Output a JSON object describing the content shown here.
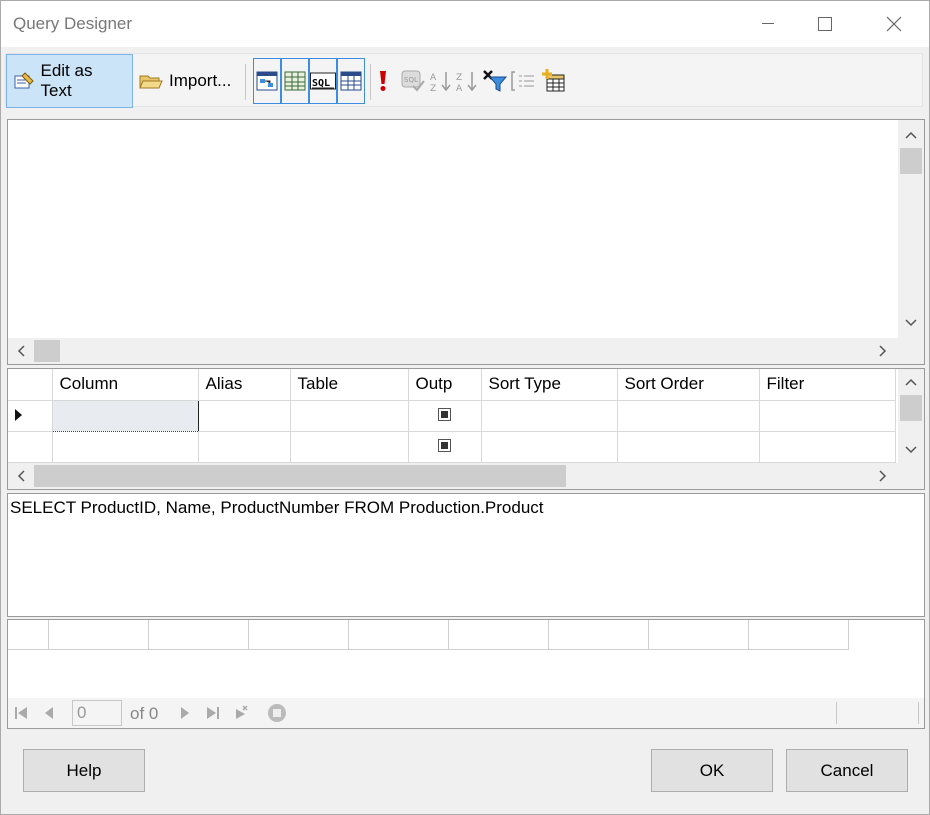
{
  "window": {
    "title": "Query Designer"
  },
  "toolbar": {
    "edit_as_text": "Edit as Text",
    "import": "Import...",
    "sql_icon_text": "SQL"
  },
  "grid": {
    "columns": [
      "",
      "Column",
      "Alias",
      "Table",
      "Outp",
      "Sort Type",
      "Sort Order",
      "Filter"
    ],
    "rows": [
      {
        "selected": true,
        "output_checked": true
      },
      {
        "selected": false,
        "output_checked": true
      }
    ]
  },
  "sql_text": "SELECT ProductID, Name, ProductNumber FROM Production.Product",
  "navigator": {
    "page": "0",
    "of_label": "of 0"
  },
  "buttons": {
    "help": "Help",
    "ok": "OK",
    "cancel": "Cancel"
  },
  "colors": {
    "active_button_bg": "#cce4f7",
    "active_border": "#7eb4ea",
    "accent_icon": "#3d8ee0",
    "execute_red": "#cc0000"
  }
}
